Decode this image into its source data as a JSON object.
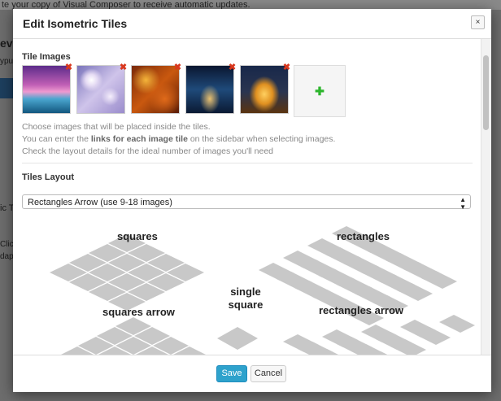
{
  "background": {
    "notice_fragment": "te your copy of Visual Composer to receive automatic updates.",
    "fragments": [
      "evi",
      "ypu",
      "ic T",
      "Click",
      "dap"
    ]
  },
  "modal": {
    "title": "Edit Isometric Tiles",
    "close_glyph": "×",
    "tile_images": {
      "label": "Tile Images",
      "images": [
        {
          "name": "pier-sunset",
          "colors": [
            "#7b3d9a",
            "#d07ac0",
            "#3a9ac5"
          ]
        },
        {
          "name": "glitter-bokeh",
          "colors": [
            "#8f86c8",
            "#e3d9f0",
            "#b4a2d8"
          ]
        },
        {
          "name": "autumn-leaves",
          "colors": [
            "#a8400f",
            "#f0a12a",
            "#5a1f08"
          ]
        },
        {
          "name": "airplane-night",
          "colors": [
            "#0d1c3a",
            "#24517f",
            "#e0b250"
          ]
        },
        {
          "name": "louvre-pyramid",
          "colors": [
            "#1a2a4a",
            "#f3b52e",
            "#6a3a12"
          ]
        }
      ],
      "remove_glyph": "✖",
      "add_glyph": "✚"
    },
    "help": {
      "line1": "Choose images that will be placed inside the tiles.",
      "line2_pre": "You can enter the ",
      "line2_bold": "links for each image tile",
      "line2_post": " on the sidebar when selecting images.",
      "line3": "Check the layout details for the ideal number of images you'll need"
    },
    "tiles_layout": {
      "label": "Tiles Layout",
      "selected": "Rectangles Arrow (use 9-18 images)",
      "arrows": "▲▼"
    },
    "layout_previews": {
      "squares": "squares",
      "rectangles": "rectangles",
      "single_square_1": "single",
      "single_square_2": "square",
      "squares_arrow": "squares arrow",
      "rectangles_arrow": "rectangles arrow",
      "tile_color": "#c8c8c8"
    },
    "footer": {
      "save": "Save",
      "cancel": "Cancel"
    }
  }
}
